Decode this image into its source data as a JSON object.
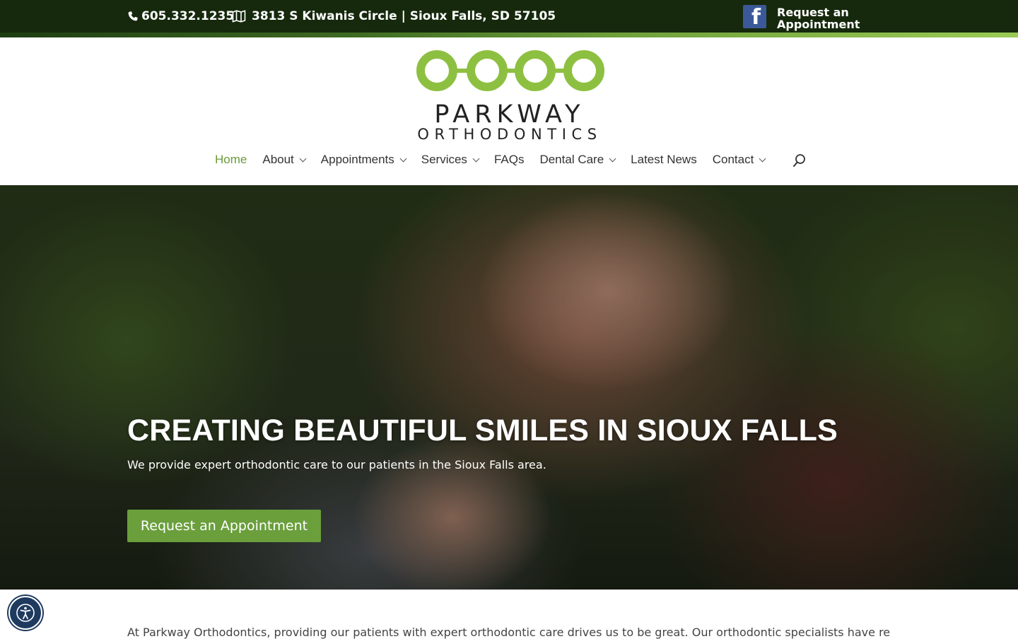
{
  "topbar": {
    "phone": "605.332.1235",
    "address": "3813 S Kiwanis Circle | Sioux Falls, SD 57105",
    "facebook_letter": "f",
    "request_label": "Request an Appointment"
  },
  "logo": {
    "word1": "PARKWAY",
    "word2": "ORTHODONTICS",
    "color_green": "#8dc041"
  },
  "nav": {
    "items": [
      {
        "label": "Home",
        "active": true,
        "has_dropdown": false
      },
      {
        "label": "About",
        "active": false,
        "has_dropdown": true
      },
      {
        "label": "Appointments",
        "active": false,
        "has_dropdown": true
      },
      {
        "label": "Services",
        "active": false,
        "has_dropdown": true
      },
      {
        "label": "FAQs",
        "active": false,
        "has_dropdown": false
      },
      {
        "label": "Dental Care",
        "active": false,
        "has_dropdown": true
      },
      {
        "label": "Latest News",
        "active": false,
        "has_dropdown": false
      },
      {
        "label": "Contact",
        "active": false,
        "has_dropdown": true
      }
    ],
    "search_icon": "search-icon",
    "active_color": "#6a9a38"
  },
  "hero": {
    "title": "CREATING BEAUTIFUL SMILES IN SIOUX FALLS",
    "subtitle": "We provide expert orthodontic care to our patients in the Sioux Falls area.",
    "button_label": "Request an Appointment",
    "button_color": "#6a9f3c"
  },
  "intro": {
    "text": "At Parkway Orthodontics, providing our patients with expert orthodontic care drives us to be great. Our orthodontic specialists have received"
  },
  "accessibility": {
    "icon": "accessibility-icon"
  }
}
